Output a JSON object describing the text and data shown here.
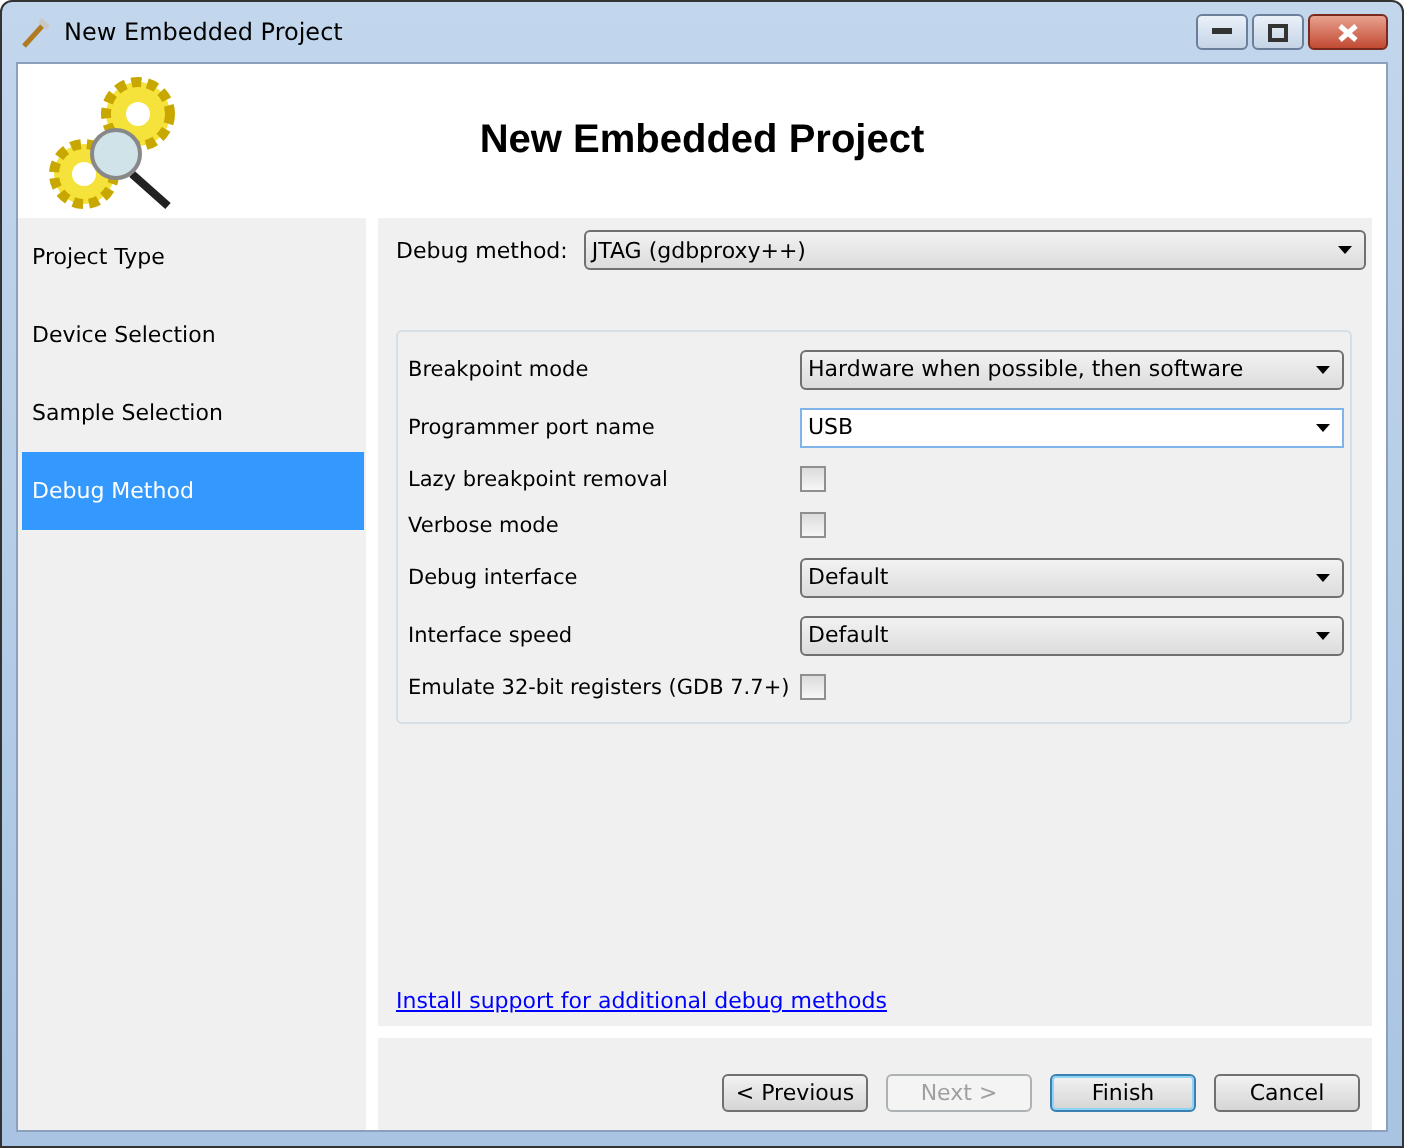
{
  "window": {
    "title": "New Embedded Project"
  },
  "header": {
    "title": "New Embedded Project"
  },
  "sidebar": {
    "items": [
      {
        "label": "Project Type",
        "selected": false
      },
      {
        "label": "Device Selection",
        "selected": false
      },
      {
        "label": "Sample Selection",
        "selected": false
      },
      {
        "label": "Debug Method",
        "selected": true
      }
    ]
  },
  "debug_method": {
    "label": "Debug method:",
    "value": "JTAG (gdbproxy++)"
  },
  "settings": [
    {
      "kind": "dropdown",
      "label": "Breakpoint mode",
      "value": "Hardware when possible, then software"
    },
    {
      "kind": "combo",
      "label": "Programmer port name",
      "value": "USB"
    },
    {
      "kind": "checkbox",
      "label": "Lazy breakpoint removal",
      "checked": false
    },
    {
      "kind": "checkbox",
      "label": "Verbose mode",
      "checked": false
    },
    {
      "kind": "dropdown",
      "label": "Debug interface",
      "value": "Default"
    },
    {
      "kind": "dropdown",
      "label": "Interface speed",
      "value": "Default"
    },
    {
      "kind": "checkbox",
      "label": "Emulate 32-bit registers (GDB 7.7+)",
      "checked": false
    }
  ],
  "link": "Install support for additional debug methods",
  "buttons": [
    {
      "label": "< Previous",
      "disabled": false,
      "default": false
    },
    {
      "label": "Next >",
      "disabled": true,
      "default": false
    },
    {
      "label": "Finish",
      "disabled": false,
      "default": true
    },
    {
      "label": "Cancel",
      "disabled": false,
      "default": false
    }
  ]
}
